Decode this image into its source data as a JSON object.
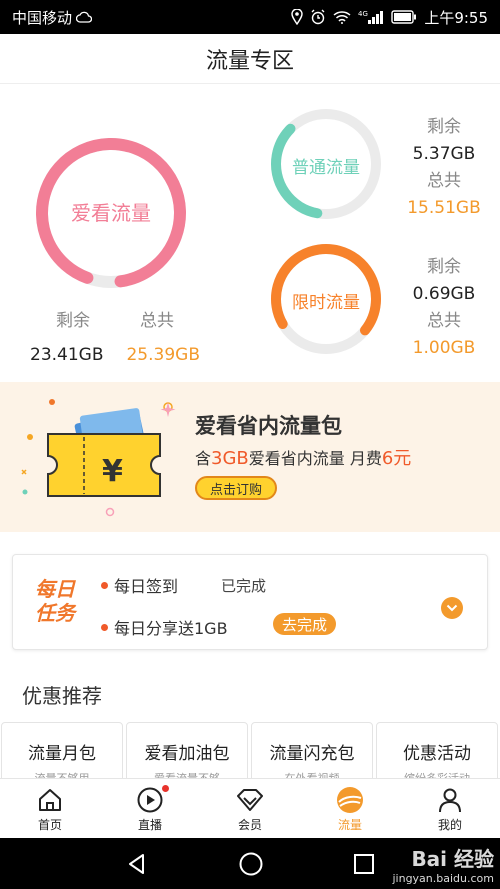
{
  "status_bar": {
    "carrier": "中国移动",
    "network": "4G",
    "time": "上午9:55"
  },
  "page": {
    "title": "流量专区"
  },
  "main_ring": {
    "label": "爱看流量",
    "remaining_label": "剩余",
    "total_label": "总共",
    "remaining": "23.41GB",
    "total": "25.39GB",
    "fraction_remaining": 0.922,
    "color": "#f27e96"
  },
  "small_rings": [
    {
      "label": "普通流量",
      "remaining_label": "剩余",
      "remaining": "5.37GB",
      "total_label": "总共",
      "total": "15.51GB",
      "fraction_remaining": 0.346,
      "color": "#6fd1b9"
    },
    {
      "label": "限时流量",
      "remaining_label": "剩余",
      "remaining": "0.69GB",
      "total_label": "总共",
      "total": "1.00GB",
      "fraction_remaining": 0.69,
      "color": "#f7822b"
    }
  ],
  "banner": {
    "title": "爱看省内流量包",
    "sub_prefix": "含",
    "sub_amount": "3GB",
    "sub_middle": "爱看省内流量  月费",
    "sub_fee": "6元",
    "button": "点击订购",
    "ticket_symbol": "¥"
  },
  "daily_tasks": {
    "logo_line1": "每日",
    "logo_line2": "任务",
    "items": [
      {
        "label": "每日签到",
        "status": "已完成"
      },
      {
        "label": "每日分享送1GB",
        "action": "去完成"
      }
    ]
  },
  "promo": {
    "section_title": "优惠推荐",
    "cards": [
      {
        "title": "流量月包",
        "subtitle": "流量不够用"
      },
      {
        "title": "爱看加油包",
        "subtitle": "爱看流量不够"
      },
      {
        "title": "流量闪充包",
        "subtitle": "在外看视频"
      },
      {
        "title": "优惠活动",
        "subtitle": "缤纷多彩活动"
      }
    ]
  },
  "tabs": [
    {
      "label": "首页",
      "icon": "home-icon"
    },
    {
      "label": "直播",
      "icon": "play-icon"
    },
    {
      "label": "会员",
      "icon": "diamond-icon"
    },
    {
      "label": "流量",
      "icon": "traffic-icon",
      "active": true
    },
    {
      "label": "我的",
      "icon": "person-icon"
    }
  ],
  "watermark": {
    "line1": "Bai 经验",
    "line2": "jingyan.baidu.com"
  },
  "colors": {
    "orange": "#f39a2c",
    "pink": "#f27e96",
    "teal": "#6fd1b9"
  }
}
